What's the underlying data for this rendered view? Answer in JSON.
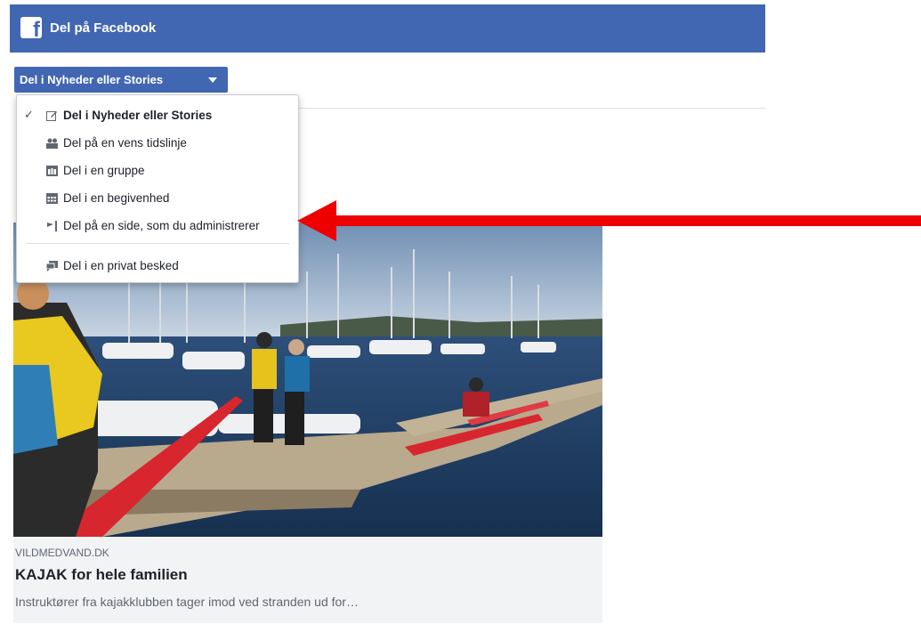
{
  "header": {
    "title": "Del på Facebook",
    "logo_icon": "facebook-logo-icon",
    "color": "#4267b2"
  },
  "share_button": {
    "label": "Del i Nyheder eller Stories",
    "caret_icon": "caret-down-icon"
  },
  "menu": {
    "items": [
      {
        "label": "Del i Nyheder eller Stories",
        "icon": "edit-icon",
        "selected": true
      },
      {
        "label": "Del på en vens tidslinje",
        "icon": "friends-icon"
      },
      {
        "label": "Del i en gruppe",
        "icon": "group-icon"
      },
      {
        "label": "Del i en begivenhed",
        "icon": "calendar-icon"
      },
      {
        "label": "Del på en side, som du administrerer",
        "icon": "page-flag-icon"
      },
      {
        "label": "Del i en privat besked",
        "icon": "message-icon"
      }
    ]
  },
  "link_preview": {
    "domain": "VILDMEDVAND.DK",
    "title": "KAJAK for hele familien",
    "description": "Instruktører fra kajakklubben tager imod ved stranden ud for…"
  },
  "annotation": {
    "arrow_color": "#ee0000"
  }
}
